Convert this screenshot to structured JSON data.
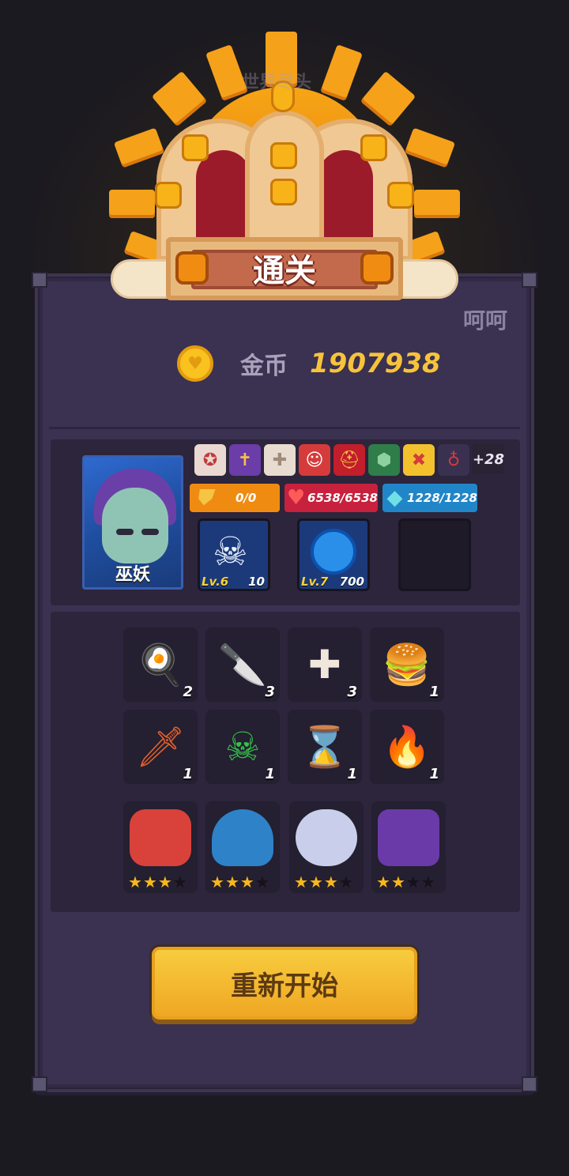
{
  "banner": {
    "title": "通关",
    "faint_text": "世界尽头"
  },
  "side_label": "呵呵",
  "gold": {
    "label": "金币",
    "value": "1907938",
    "icon": "coin-icon"
  },
  "hero": {
    "name": "巫妖",
    "effects": [
      "pentagram-icon",
      "coffin-icon",
      "holy-cross-icon",
      "clown-icon",
      "helmet-icon",
      "turtle-shell-icon",
      "shield-x-icon",
      "potion-necklace-icon"
    ],
    "extra_effects": "+28",
    "shield": "0/0",
    "hp": "6538/6538",
    "mana": "1228/1228",
    "slots": [
      {
        "icon": "skull-icon",
        "level": "Lv.6",
        "count": "10"
      },
      {
        "icon": "blue-orb-icon",
        "level": "Lv.7",
        "count": "700"
      }
    ]
  },
  "items": [
    {
      "icon": "hotdog-bun-icon",
      "count": "2"
    },
    {
      "icon": "knife-icon",
      "count": "3"
    },
    {
      "icon": "cross-icon",
      "count": "3"
    },
    {
      "icon": "burger-icon",
      "count": "1"
    },
    {
      "icon": "cleaver-icon",
      "count": "1"
    },
    {
      "icon": "poison-bottle-icon",
      "count": "1"
    },
    {
      "icon": "hourglass-icon",
      "count": "1"
    },
    {
      "icon": "torch-icon",
      "count": "1"
    }
  ],
  "monsters": [
    {
      "icon": "red-dragon-icon",
      "stars": 3
    },
    {
      "icon": "blue-ghost-icon",
      "stars": 3
    },
    {
      "icon": "pirate-slime-icon",
      "stars": 3
    },
    {
      "icon": "purple-golem-icon",
      "stars": 2
    }
  ],
  "restart_label": "重新开始",
  "colors": {
    "gold": "#f7c33b",
    "panel": "#322a45",
    "button": "#f0a723"
  }
}
